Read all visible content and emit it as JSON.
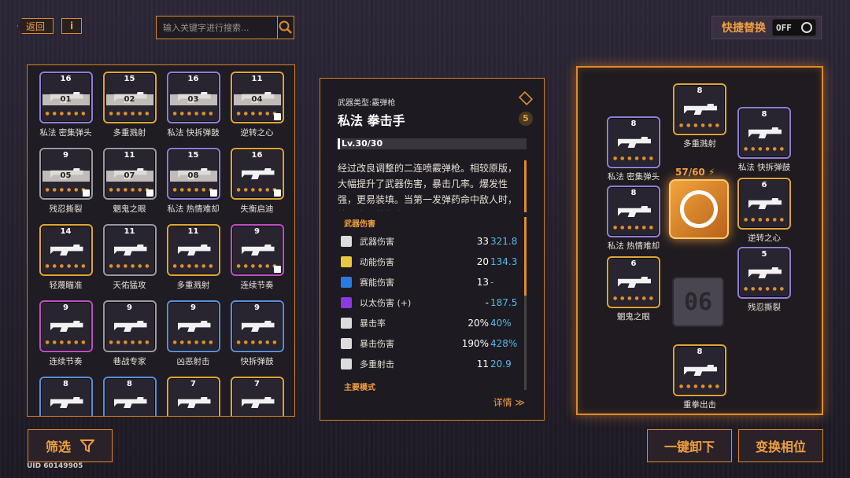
{
  "topbar": {
    "back_label": "返回",
    "info_label": "i",
    "search_placeholder": "输入关键字进行搜索...",
    "quick_label": "快捷替换",
    "toggle_text": "OFF"
  },
  "inventory": [
    {
      "level": "16",
      "name": "私法 密集弹头",
      "band": "01",
      "color": "purple",
      "locked": false
    },
    {
      "level": "15",
      "name": "多重溅射",
      "band": "02",
      "color": "gold",
      "locked": false
    },
    {
      "level": "16",
      "name": "私法 快拆弹鼓",
      "band": "03",
      "color": "purple",
      "locked": false
    },
    {
      "level": "11",
      "name": "逆转之心",
      "band": "04",
      "color": "gold",
      "locked": true
    },
    {
      "level": "9",
      "name": "残忍撕裂",
      "band": "05",
      "color": "white",
      "locked": true
    },
    {
      "level": "11",
      "name": "魍鬼之眼",
      "band": "07",
      "color": "white",
      "locked": true
    },
    {
      "level": "15",
      "name": "私法 热情难却",
      "band": "08",
      "color": "purple",
      "locked": true
    },
    {
      "level": "16",
      "name": "失衡启迪",
      "band": "",
      "color": "gold",
      "locked": true
    },
    {
      "level": "14",
      "name": "轻蔑瞄准",
      "band": "",
      "color": "gold",
      "locked": false
    },
    {
      "level": "11",
      "name": "天佑猛攻",
      "band": "",
      "color": "white",
      "locked": false
    },
    {
      "level": "11",
      "name": "多重溅射",
      "band": "",
      "color": "gold",
      "locked": false
    },
    {
      "level": "9",
      "name": "连续节奏",
      "band": "",
      "color": "magenta",
      "locked": true
    },
    {
      "level": "9",
      "name": "连续节奏",
      "band": "",
      "color": "magenta",
      "locked": false
    },
    {
      "level": "9",
      "name": "巷战专家",
      "band": "",
      "color": "white",
      "locked": false
    },
    {
      "level": "9",
      "name": "凶恶射击",
      "band": "",
      "color": "blue",
      "locked": false
    },
    {
      "level": "9",
      "name": "快拆弹鼓",
      "band": "",
      "color": "blue",
      "locked": false
    },
    {
      "level": "8",
      "name": "",
      "band": "",
      "color": "blue",
      "locked": false
    },
    {
      "level": "8",
      "name": "",
      "band": "",
      "color": "blue",
      "locked": false
    },
    {
      "level": "7",
      "name": "",
      "band": "",
      "color": "gold",
      "locked": false
    },
    {
      "level": "7",
      "name": "",
      "band": "",
      "color": "gold",
      "locked": false
    }
  ],
  "detail": {
    "type": "武器类型:霰弹枪",
    "title": "私法 拳击手",
    "badge": "5",
    "level": "Lv.30/30",
    "description": "经过改良调整的二连喷霰弹枪。相较原版，大幅提升了武器伤害，暴击几率。爆发性强，更易装填。当第一发弹药命中敌人时，第二发弹药伤害提升",
    "section_damage": "武器伤害",
    "stats": [
      {
        "name": "武器伤害",
        "v1": "33",
        "v2": "321.8",
        "icon": "weapon-icon",
        "color": "#dcdcdc"
      },
      {
        "name": "动能伤害",
        "v1": "20",
        "v2": "134.3",
        "icon": "kinetic-icon",
        "color": "#e8c840"
      },
      {
        "name": "赛能伤害",
        "v1": "13",
        "v2": "-",
        "icon": "psi-icon",
        "color": "#2a7ae0"
      },
      {
        "name": "以太伤害 (+)",
        "v1": "-",
        "v2": "187.5",
        "icon": "ether-icon",
        "color": "#8a3ae0"
      },
      {
        "name": "暴击率",
        "v1": "20%",
        "v2": "40%",
        "icon": "crit-rate-icon",
        "color": "#dcdcdc"
      },
      {
        "name": "暴击伤害",
        "v1": "190%",
        "v2": "428%",
        "icon": "crit-damage-icon",
        "color": "#dcdcdc"
      },
      {
        "name": "多重射击",
        "v1": "11",
        "v2": "20.9",
        "icon": "multishot-icon",
        "color": "#dcdcdc"
      }
    ],
    "section_mode": "主要模式",
    "more_label": "详情 ≫"
  },
  "equip": {
    "energy": "57/60 ⚡",
    "empty_label": "06",
    "slots": [
      {
        "level": "8",
        "name": "多重溅射",
        "color": "gold"
      },
      {
        "level": "8",
        "name": "私法 密集弹头",
        "color": "purple"
      },
      {
        "level": "8",
        "name": "私法 快拆弹鼓",
        "color": "purple"
      },
      {
        "level": "8",
        "name": "私法 热情难却",
        "color": "purple"
      },
      {
        "level": "6",
        "name": "逆转之心",
        "color": "gold"
      },
      {
        "level": "6",
        "name": "魍鬼之眼",
        "color": "gold"
      },
      {
        "level": "5",
        "name": "残忍撕裂",
        "color": "purple"
      },
      {
        "level": "8",
        "name": "重拳出击",
        "color": "gold"
      }
    ]
  },
  "bottom": {
    "filter_label": "筛选",
    "uid": "UID 60149905",
    "unequip_all": "一键卸下",
    "swap_phase": "变换相位"
  },
  "colors": {
    "accent": "#e08a2a",
    "crit_blue": "#58b8e8"
  }
}
